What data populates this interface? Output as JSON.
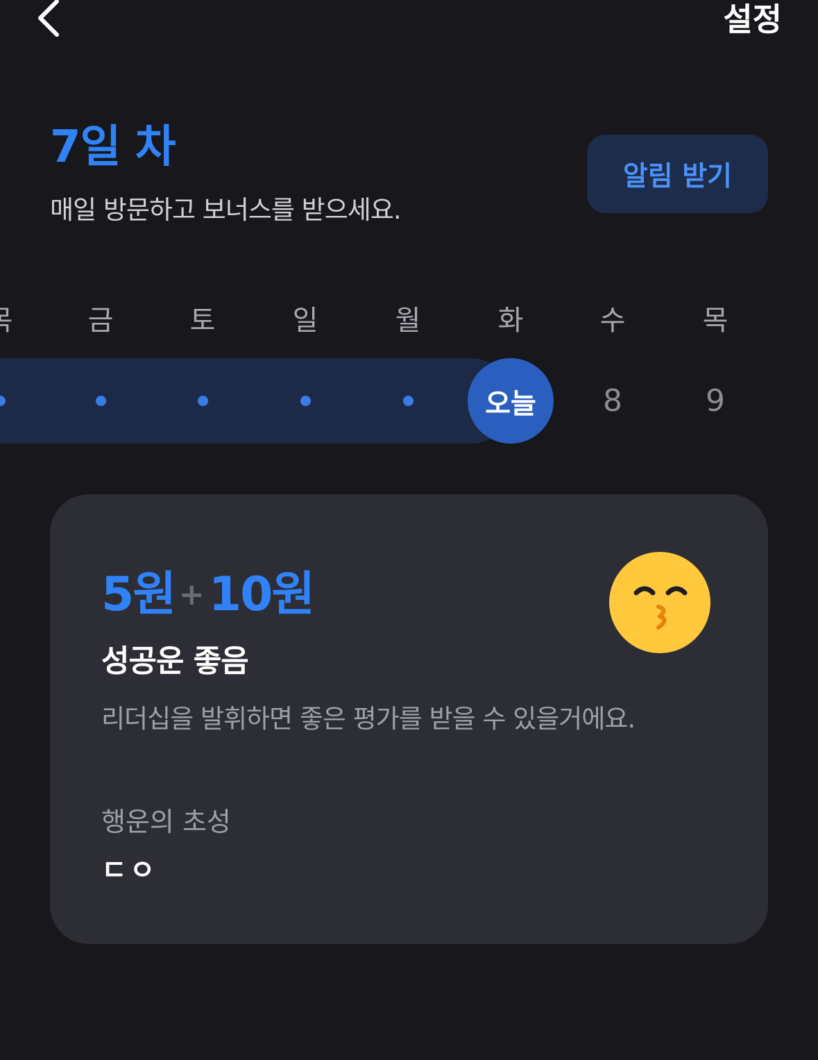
{
  "header": {
    "back_icon": "chevron-left-icon",
    "settings_label": "설정"
  },
  "intro": {
    "day_title": "7일 차",
    "subtitle": "매일 방문하고 보너스를 받으세요.",
    "notify_button_label": "알림 받기"
  },
  "calendar": {
    "weekdays": [
      "목",
      "금",
      "토",
      "일",
      "월",
      "화",
      "수",
      "목"
    ],
    "days": [
      {
        "state": "visited"
      },
      {
        "state": "visited"
      },
      {
        "state": "visited"
      },
      {
        "state": "visited"
      },
      {
        "state": "visited"
      },
      {
        "state": "today",
        "label": "오늘"
      },
      {
        "state": "future",
        "label": "8"
      },
      {
        "state": "future",
        "label": "9"
      }
    ],
    "today_label": "오늘",
    "future_labels": [
      "8",
      "9"
    ]
  },
  "fortune_card": {
    "reward_base": "5원",
    "reward_plus": "+",
    "reward_bonus": "10원",
    "title": "성공운 좋음",
    "description": "리더십을 발휘하면 좋은 평가를 받을 수 있을거에요.",
    "initials_label": "행운의 초성",
    "initials_value": "ㄷㅇ",
    "emoji_icon": "kissing-face-emoji"
  },
  "colors": {
    "background": "#17171c",
    "accent": "#3182f6",
    "card": "#2c2d35",
    "track": "#1c2a47",
    "today_circle": "#2b5fbf",
    "notify_button_bg": "#1c2c4a"
  }
}
